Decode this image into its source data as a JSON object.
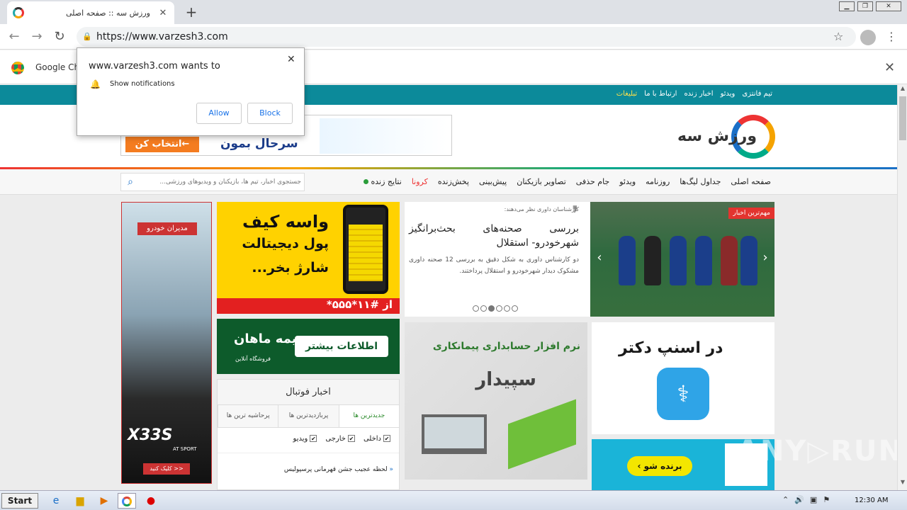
{
  "browser": {
    "tab_title": "ورزش سه :: صفحه اصلی",
    "tab_close": "✕",
    "new_tab": "+",
    "url": "https://www.varzesh3.com",
    "back": "←",
    "forward": "→",
    "reload": "↻",
    "star": "☆",
    "menu": "⋮",
    "window_min": "▁",
    "window_max": "❐",
    "window_close": "✕"
  },
  "infobar": {
    "text": "Google Ch",
    "close": "✕"
  },
  "popup": {
    "title": "www.varzesh3.com wants to",
    "permission": "Show notifications",
    "allow": "Allow",
    "block": "Block",
    "close": "✕"
  },
  "site": {
    "top_links": [
      "تیم فانتزی",
      "ویدئو",
      "اخبار زنده",
      "ارتباط با ما",
      "تبلیغات"
    ],
    "logo_text": "ورزش سه",
    "main_nav": [
      "صفحه اصلی",
      "جداول لیگ‌ها",
      "روزنامه",
      "ویدئو",
      "جام حذفی",
      "تصاویر بازیکنان",
      "پیش‌بینی",
      "پخش‌زنده",
      "کرونا",
      "نتایج زنده"
    ],
    "search_placeholder": "جستجوی اخبار، تیم ها، بازیکنان و ویدیوهای ورزشی..."
  },
  "ads": {
    "top_cta": "انتخاب کن←",
    "top_slogan": "سرحال بمون",
    "left_brand": "مدیران خودرو",
    "left_model": "X33S",
    "left_sub": "AT SPORT",
    "left_cta": "کلیک کنید >>",
    "charge_l1": "واسه کیف",
    "charge_l2": "پول دیجیتالت",
    "charge_l3": "شارژ بخر...",
    "charge_code": "از #۱۱*۵۵۵*",
    "mahan_button": "اطلاعات بیشتر",
    "mahan_name": "بیمه ماهان",
    "mahan_sub": "فروشگاه آنلاین",
    "sepidar_l1": "نرم افزار حسابداری پیمانکاری",
    "sepidar_l2": "سپیدار",
    "snapp_title": "در اسنپ دکتر",
    "winner_button": "برنده شو"
  },
  "slider": {
    "badge": "مهم‌ترین اخبار",
    "kicker": "کارشناسان داوری نظر می‌دهند:",
    "headline": "بررسی صحنه‌های بحث‌برانگیز شهرخودرو- استقلال",
    "summary": "دو کارشناس داوری به شکل دقیق به بررسی 12 صحنه داوری مشکوک دیدار شهرخودرو و استقلال پرداختند.",
    "prev": "‹",
    "next": "›",
    "active_dot": 2
  },
  "news": {
    "header": "اخبار فوتبال",
    "tabs": [
      "جدیدترین ها",
      "پربازدیدترین ها",
      "پرحاشیه ترین ها"
    ],
    "filters": [
      "داخلی",
      "خارجی",
      "ویدیو"
    ],
    "item1": "لحظه عجیب جشن قهرمانی پرسپولیس"
  },
  "watermark": "ANY▷RUN",
  "taskbar": {
    "start": "Start",
    "clock": "12:30 AM"
  }
}
